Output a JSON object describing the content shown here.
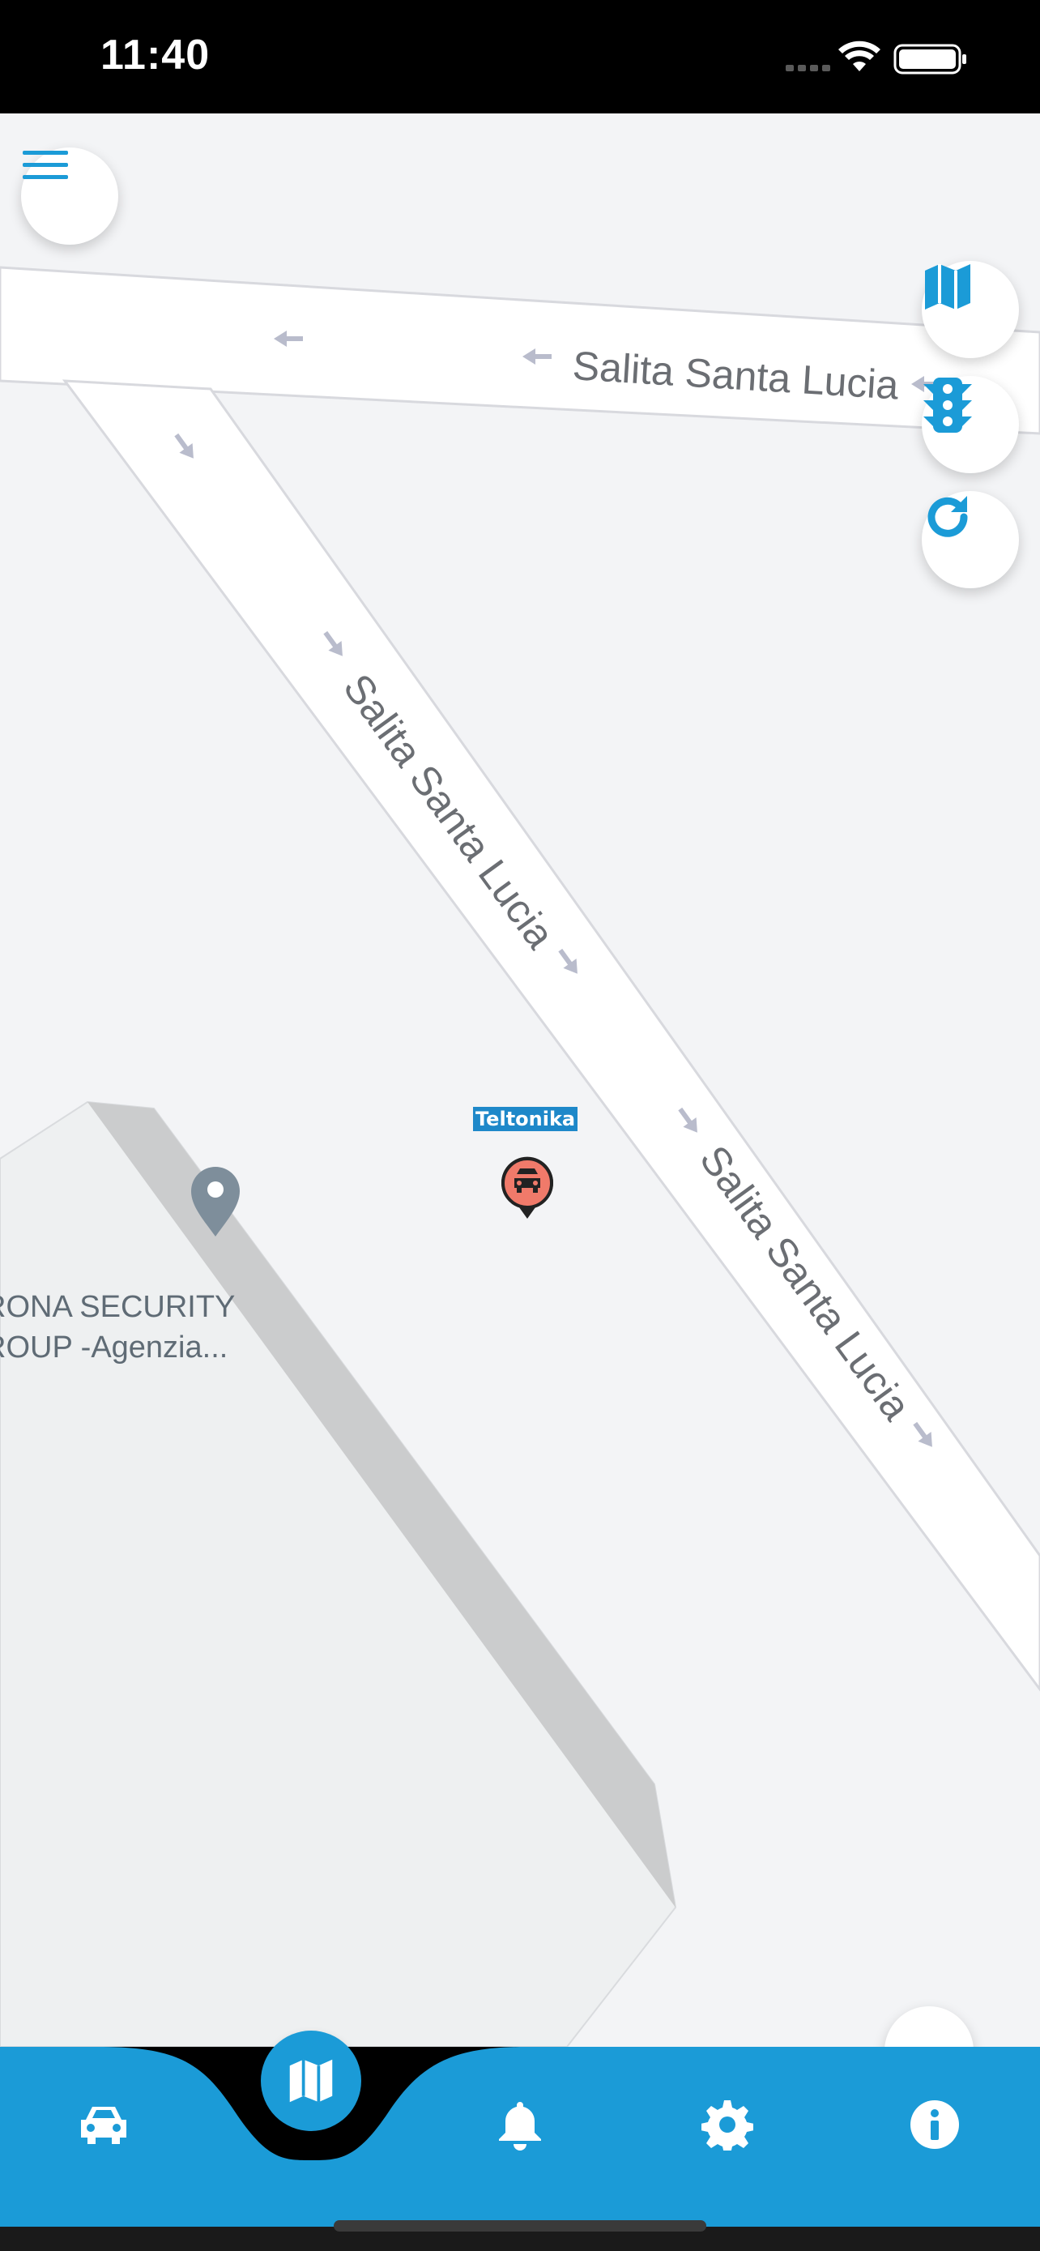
{
  "status_bar": {
    "time": "11:40"
  },
  "map": {
    "roads": [
      {
        "name": "Salita Santa Lucia"
      },
      {
        "name": "Salita Santa Lucia"
      },
      {
        "name": "Salita Santa Lucia"
      }
    ],
    "poi": {
      "line1": "RONA SECURITY",
      "line2": "ROUP -Agenzia..."
    },
    "vehicle": {
      "label": "Teltonika",
      "icon": "car-marker-icon"
    }
  },
  "controls": {
    "menu": "menu-icon",
    "map_type": "map-icon",
    "traffic": "traffic-light-icon",
    "refresh": "refresh-icon"
  },
  "tabbar": {
    "tabs": [
      {
        "icon": "car-icon",
        "active": false
      },
      {
        "icon": "map-icon",
        "active": true
      },
      {
        "icon": "bell-icon",
        "active": false
      },
      {
        "icon": "gear-icon",
        "active": false
      },
      {
        "icon": "info-icon",
        "active": false
      }
    ]
  },
  "colors": {
    "accent": "#1b9bd7",
    "marker": "#f07a6a"
  }
}
